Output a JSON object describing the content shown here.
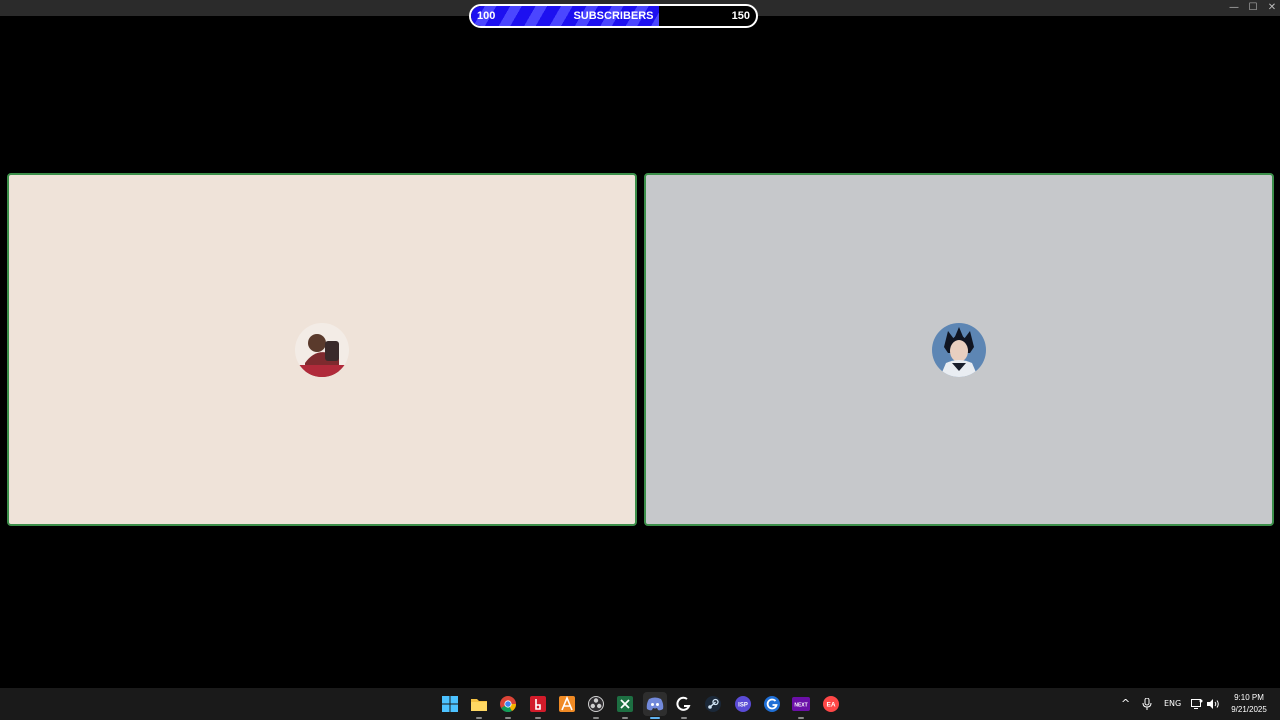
{
  "window": {
    "minimize_glyph": "—",
    "maximize_glyph": "☐",
    "close_glyph": "✕"
  },
  "goal": {
    "min": "100",
    "label": "SUBSCRIBERS",
    "max": "150",
    "progress": 0.66
  },
  "participants": [
    {
      "avatar_icon": "user-avatar-photo",
      "tile_color": "#efe3d9"
    },
    {
      "avatar_icon": "anime-character-avatar",
      "tile_color": "#c6c8cb"
    }
  ],
  "taskbar": {
    "apps": [
      {
        "name": "windows-start-icon"
      },
      {
        "name": "file-explorer-icon"
      },
      {
        "name": "chrome-icon"
      },
      {
        "name": "app-red-icon"
      },
      {
        "name": "app-orange-icon"
      },
      {
        "name": "obs-icon"
      },
      {
        "name": "excel-icon"
      },
      {
        "name": "discord-icon"
      },
      {
        "name": "logitech-icon"
      },
      {
        "name": "steam-icon"
      },
      {
        "name": "isp-icon",
        "label": "ISP"
      },
      {
        "name": "browser-g-icon"
      },
      {
        "name": "next-icon",
        "label": "NEXT"
      },
      {
        "name": "ea-icon",
        "label": "EA"
      }
    ],
    "tray": {
      "chevron": "^",
      "language": "ENG",
      "time": "9:10 PM",
      "date": "9/21/2025"
    }
  }
}
